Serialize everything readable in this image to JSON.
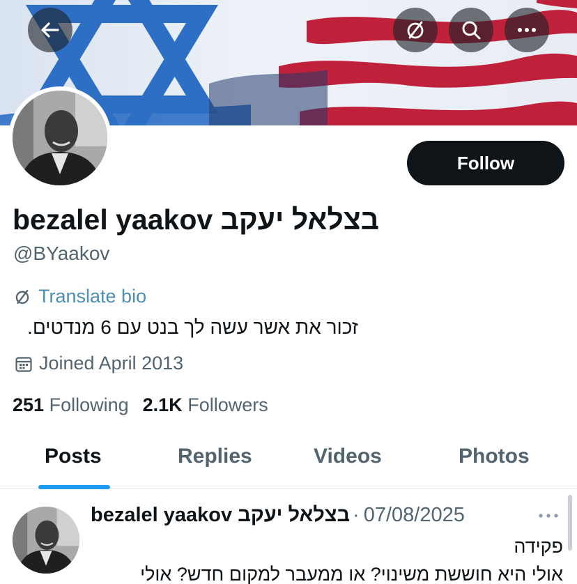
{
  "header": {
    "buttons": [
      {
        "name": "back",
        "icon": "arrow-left-icon"
      },
      {
        "name": "translate",
        "icon": "translate-icon"
      },
      {
        "name": "search",
        "icon": "search-icon"
      },
      {
        "name": "more",
        "icon": "more-horizontal-icon"
      }
    ],
    "banner_colors": {
      "israel_blue": "#2d6fc4",
      "usa_red": "#c0213a",
      "usa_navy": "#233a6e",
      "white": "#f4f6fa"
    }
  },
  "profile": {
    "display_name": "bezalel yaakov בצלאל יעקב",
    "handle": "@BYaakov",
    "follow_label": "Follow",
    "translate_bio_label": "Translate bio",
    "bio": "זכור את אשר עשה לך בנט עם 6 מנדטים.",
    "joined": "Joined April 2013",
    "following_count": "251",
    "following_label": "Following",
    "followers_count": "2.1K",
    "followers_label": "Followers"
  },
  "tabs": [
    {
      "label": "Posts",
      "active": true
    },
    {
      "label": "Replies",
      "active": false
    },
    {
      "label": "Videos",
      "active": false
    },
    {
      "label": "Photos",
      "active": false
    }
  ],
  "post": {
    "author_name": "bezalel yaakov בצלאל יעקב",
    "separator": "·",
    "date": "07/08/2025",
    "line1": "פקידה",
    "line2": "אולי היא חוששת משינוי? או ממעבר למקום חדש? אולי"
  },
  "colors": {
    "accent": "#1d9bf0",
    "translate_link": "#4b8fb5",
    "muted_text": "#536471",
    "primary_text": "#0f1419"
  }
}
